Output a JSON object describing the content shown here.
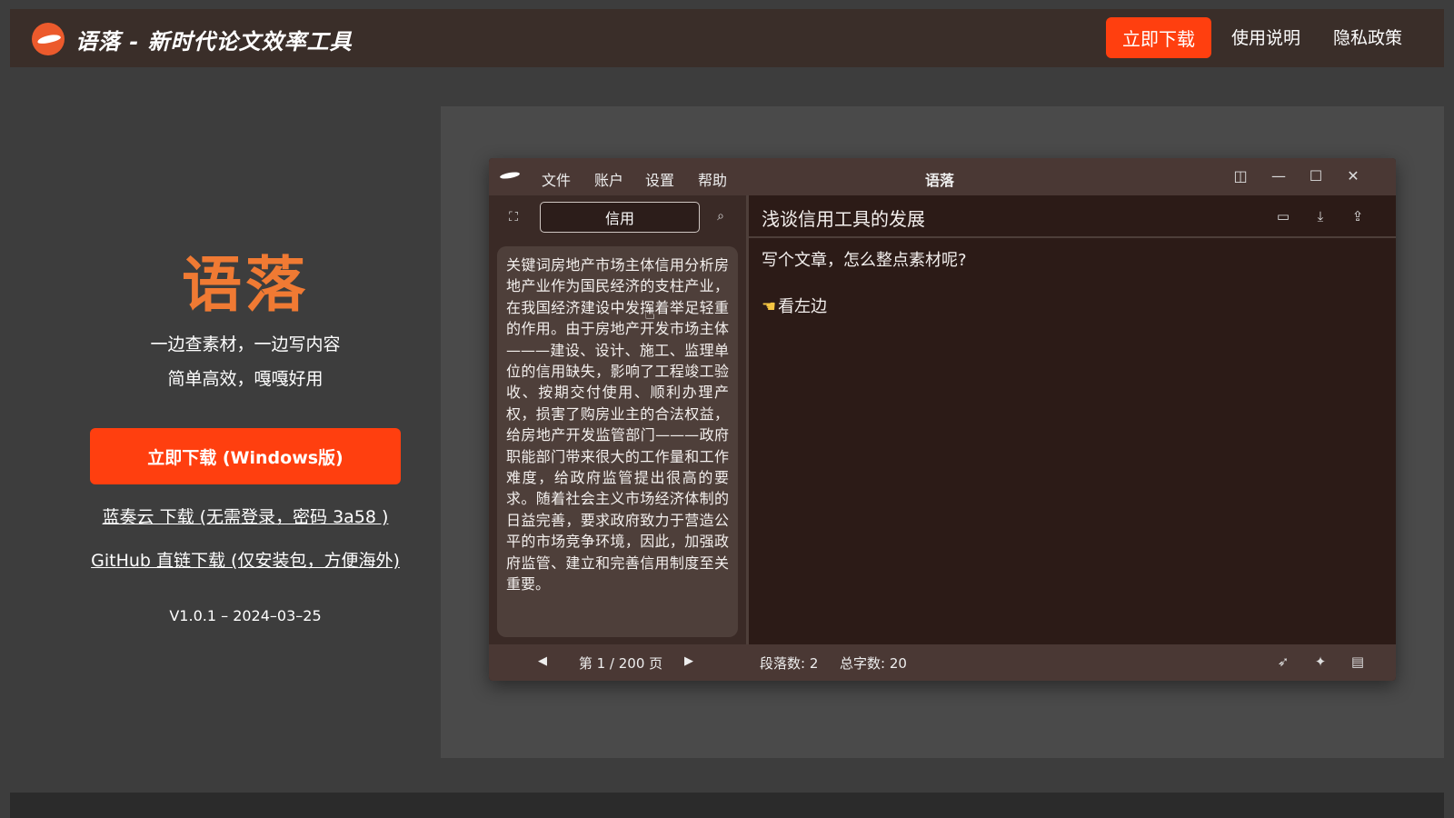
{
  "header": {
    "site_title": "语落 - 新时代论文效率工具",
    "download_label": "立即下载",
    "help_label": "使用说明",
    "privacy_label": "隐私政策"
  },
  "hero": {
    "brand": "语落",
    "tagline_1": "一边查素材，一边写内容",
    "tagline_2": "简单高效，嘎嘎好用",
    "main_download_label": "立即下载 (Windows版)",
    "lanzou_link": "蓝奏云 下载 (无需登录，密码 3a58 )",
    "github_link": "GitHub 直链下载 (仅安装包，方便海外)",
    "version": "V1.0.1 – 2024–03–25"
  },
  "app": {
    "title": "语落",
    "menu": [
      "文件",
      "账户",
      "设置",
      "帮助"
    ],
    "search_value": "信用",
    "material_text": "关键词房地产市场主体信用分析房地产业作为国民经济的支柱产业，在我国经济建设中发挥着举足轻重的作用。由于房地产开发市场主体———建设、设计、施工、监理单位的信用缺失，影响了工程竣工验收、按期交付使用、顺利办理产权，损害了购房业主的合法权益，给房地产开发监管部门———政府职能部门带来很大的工作量和工作难度，给政府监管提出很高的要求。随着社会主义市场经济体制的日益完善，要求政府致力于营造公平的市场竞争环境，因此，加强政府监管、建立和完善信用制度至关重要。",
    "doc_title": "浅谈信用工具的发展",
    "doc_line1": "写个文章，怎么整点素材呢?",
    "doc_line2": "看左边",
    "page_indicator": "第 1 / 200 页",
    "paragraph_count": "段落数: 2",
    "word_count": "总字数: 20"
  },
  "colors": {
    "accent": "#ff3f0f",
    "brand_orange": "#f07a33",
    "page_bg": "#3d3d3d",
    "header_bg": "#3a2e29"
  }
}
